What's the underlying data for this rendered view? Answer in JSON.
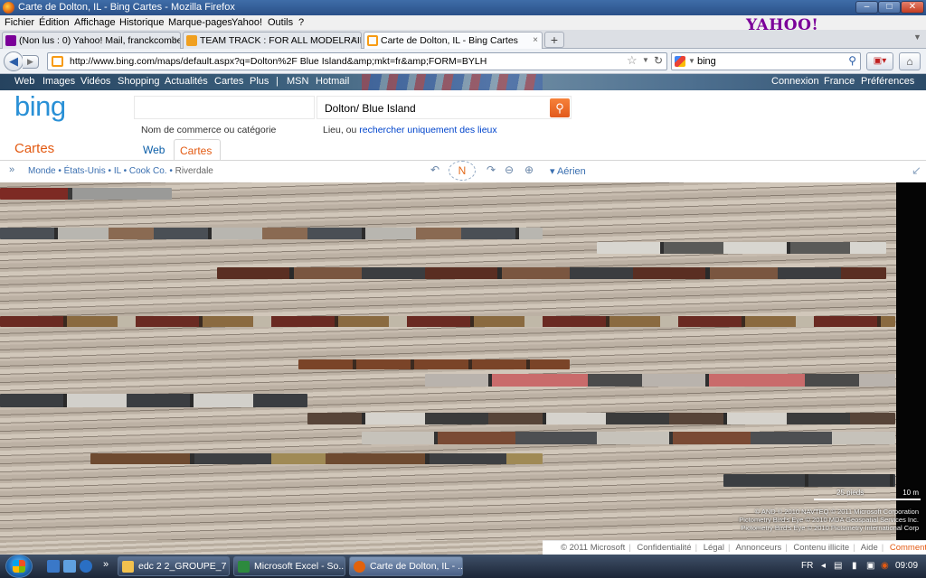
{
  "window": {
    "title": "Carte de Dolton, IL - Bing Cartes - Mozilla Firefox",
    "min": "–",
    "max": "□",
    "close": "✕"
  },
  "menu": [
    "Fichier",
    "Édition",
    "Affichage",
    "Historique",
    "Marque-pages",
    "Yahoo!",
    "Outils",
    "?"
  ],
  "yahoo_logo": "YAHOO!",
  "tabs": [
    {
      "label": "(Non lus : 0) Yahoo! Mail, franckcombe",
      "icon": "yahoo-mail-icon",
      "color": "#7b0099"
    },
    {
      "label": "TEAM TRACK : FOR ALL MODELRAIL...",
      "icon": "forum-icon",
      "color": "#f0a020"
    },
    {
      "label": "Carte de Dolton, IL - Bing Cartes",
      "icon": "bing-icon",
      "color": "#f79b14"
    }
  ],
  "tab_close": "×",
  "new_tab": "+",
  "nav": {
    "url": "http://www.bing.com/maps/default.aspx?q=Dolton%2F Blue Island&amp;mkt=fr&amp;FORM=BYLH",
    "search_value": "bing"
  },
  "bing": {
    "top_links": [
      "Web",
      "Images",
      "Vidéos",
      "Shopping",
      "Actualités",
      "Cartes",
      "Plus",
      "|",
      "MSN",
      "Hotmail"
    ],
    "right_links": [
      "Connexion",
      "France",
      "Préférences"
    ],
    "logo": "bing",
    "what_value": "",
    "where_value": "Dolton/ Blue Island",
    "what_hint": "Nom de commerce ou catégorie",
    "where_hint_prefix": "Lieu, ou ",
    "where_hint_link": "rechercher uniquement des lieux",
    "section_title": "Cartes",
    "tab_web": "Web",
    "tab_cartes": "Cartes"
  },
  "map_toolbar": {
    "expand": "»",
    "breadcrumbs": [
      "Monde",
      "États-Unis",
      "IL",
      "Cook Co."
    ],
    "breadcrumb_last": "Riverdale",
    "compass": "N",
    "aerial": "▾ Aérien",
    "zoom_out": "⊖",
    "zoom_in": "⊕",
    "collapse": "↙"
  },
  "map": {
    "scale_left": "25 pieds",
    "scale_right": "10 m",
    "attribution": [
      "© AND  © 2010 NAVTEQ  © 2011 Microsoft Corporation",
      "Pictometry Bird's Eye © 2010 MDA Geospatial Services Inc.",
      "Pictometry Bird's Eye © 2010 Pictometry International Corp"
    ]
  },
  "footer": [
    "© 2011 Microsoft",
    "Confidentialité",
    "Légal",
    "Annonceurs",
    "Contenu illicite",
    "Aide",
    "Commentaires"
  ],
  "taskbar": {
    "tasks": [
      {
        "label": "edc 2 2_GROUPE_7",
        "icon": "folder-icon",
        "color": "#f2c14e"
      },
      {
        "label": "Microsoft Excel - So...",
        "icon": "excel-icon",
        "color": "#2d8a3e"
      },
      {
        "label": "Carte de Dolton, IL - ...",
        "icon": "firefox-icon",
        "color": "#e2620c"
      }
    ],
    "lang": "FR",
    "clock": "09:09"
  }
}
